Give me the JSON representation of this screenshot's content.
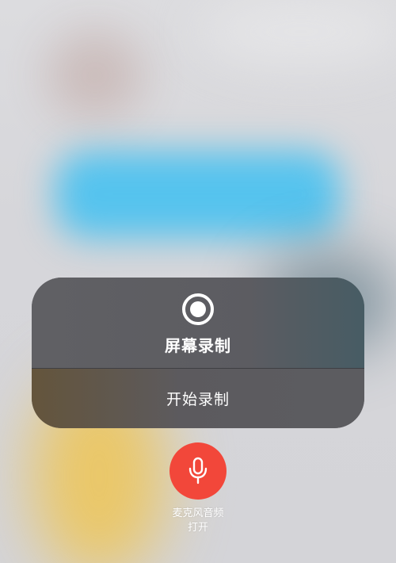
{
  "screen_recording": {
    "title": "屏幕录制",
    "start_label": "开始录制",
    "icon": "record-icon"
  },
  "microphone": {
    "label": "麦克风音频",
    "status": "打开",
    "icon": "microphone-icon",
    "active_color": "#f2473a"
  }
}
